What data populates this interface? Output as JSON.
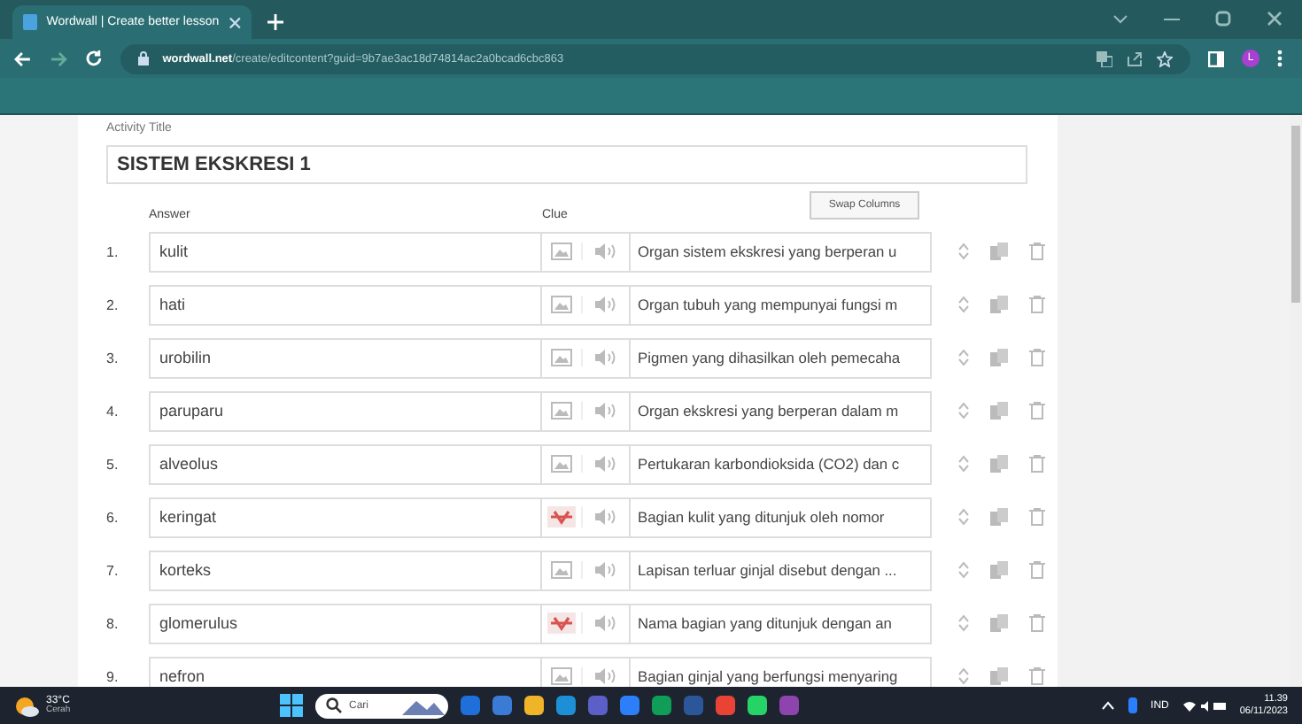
{
  "browser": {
    "tab_title": "Wordwall | Create better lesson",
    "url_domain": "wordwall.net",
    "url_path": "/create/editcontent?guid=9b7ae3ac18d74814ac2a0bcad6cbc863",
    "profile_initial": "L"
  },
  "editor": {
    "title_label": "Activity Title",
    "title_value": "SISTEM EKSKRESI 1",
    "answer_header": "Answer",
    "clue_header": "Clue",
    "swap_button": "Swap Columns",
    "rows": [
      {
        "number": "1.",
        "answer": "kulit",
        "clue": "Organ sistem ekskresi yang berperan u",
        "has_image": false
      },
      {
        "number": "2.",
        "answer": "hati",
        "clue": "Organ tubuh yang mempunyai fungsi m",
        "has_image": false
      },
      {
        "number": "3.",
        "answer": "urobilin",
        "clue": "Pigmen yang dihasilkan oleh pemecaha",
        "has_image": false
      },
      {
        "number": "4.",
        "answer": "paruparu",
        "clue": "Organ ekskresi yang berperan dalam m",
        "has_image": false
      },
      {
        "number": "5.",
        "answer": "alveolus",
        "clue": "Pertukaran karbondioksida (CO2) dan c",
        "has_image": false
      },
      {
        "number": "6.",
        "answer": "keringat",
        "clue": "Bagian kulit yang ditunjuk oleh nomor",
        "has_image": true
      },
      {
        "number": "7.",
        "answer": "korteks",
        "clue": "Lapisan terluar ginjal disebut dengan ...",
        "has_image": false
      },
      {
        "number": "8.",
        "answer": "glomerulus",
        "clue": "Nama bagian yang ditunjuk dengan an",
        "has_image": true
      },
      {
        "number": "9.",
        "answer": "nefron",
        "clue": "Bagian ginjal yang berfungsi menyaring",
        "has_image": false
      }
    ]
  },
  "taskbar": {
    "temperature": "33°C",
    "weather": "Cerah",
    "search_placeholder": "Cari",
    "language": "IND",
    "time": "11.39",
    "date": "06/11/2023"
  }
}
